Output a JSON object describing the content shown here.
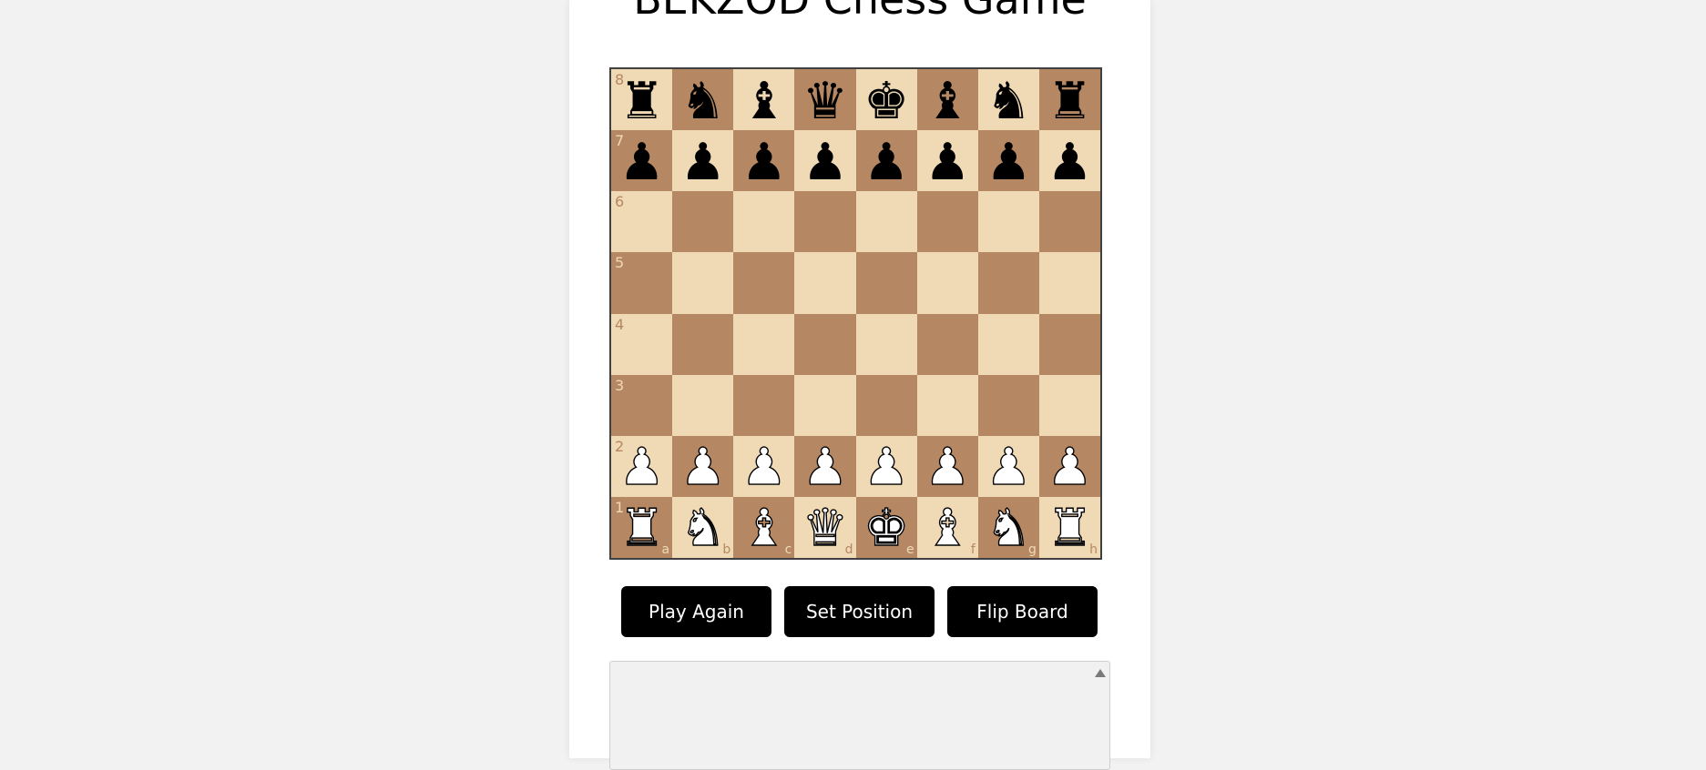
{
  "title": "BEKZOD Chess Game",
  "colors": {
    "light_square": "#f0d9b5",
    "dark_square": "#b58863",
    "button_bg": "#000000"
  },
  "board": {
    "files": [
      "a",
      "b",
      "c",
      "d",
      "e",
      "f",
      "g",
      "h"
    ],
    "ranks": [
      "8",
      "7",
      "6",
      "5",
      "4",
      "3",
      "2",
      "1"
    ],
    "position": [
      [
        "bR",
        "bN",
        "bB",
        "bQ",
        "bK",
        "bB",
        "bN",
        "bR"
      ],
      [
        "bP",
        "bP",
        "bP",
        "bP",
        "bP",
        "bP",
        "bP",
        "bP"
      ],
      [
        "",
        "",
        "",
        "",
        "",
        "",
        "",
        ""
      ],
      [
        "",
        "",
        "",
        "",
        "",
        "",
        "",
        ""
      ],
      [
        "",
        "",
        "",
        "",
        "",
        "",
        "",
        ""
      ],
      [
        "",
        "",
        "",
        "",
        "",
        "",
        "",
        ""
      ],
      [
        "wP",
        "wP",
        "wP",
        "wP",
        "wP",
        "wP",
        "wP",
        "wP"
      ],
      [
        "wR",
        "wN",
        "wB",
        "wQ",
        "wK",
        "wB",
        "wN",
        "wR"
      ]
    ],
    "glyphs": {
      "K": "♚",
      "Q": "♛",
      "R": "♜",
      "B": "♝",
      "N": "♞",
      "P": "♟"
    }
  },
  "buttons": {
    "play_again": "Play Again",
    "set_position": "Set Position",
    "flip_board": "Flip Board"
  },
  "move_log": {
    "text": ""
  }
}
